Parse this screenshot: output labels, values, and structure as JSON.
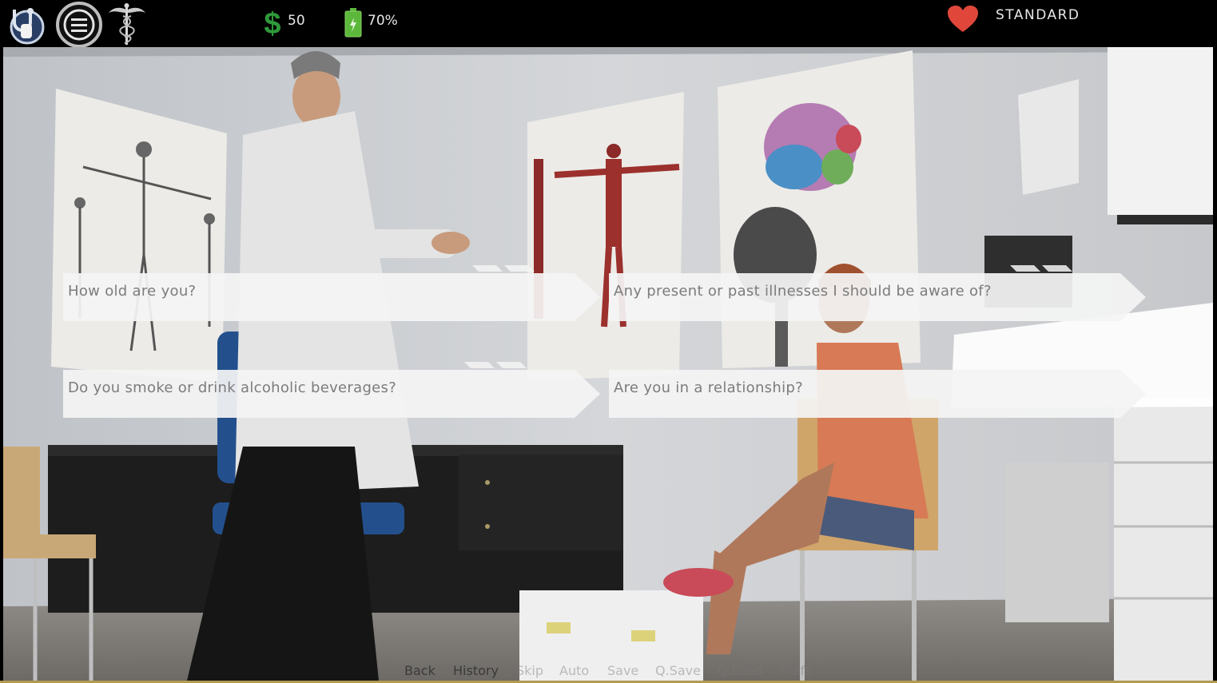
{
  "hud": {
    "money_value": "50",
    "energy_value": "70%",
    "difficulty": "STANDARD",
    "icons": [
      "stethoscope-logo-icon",
      "menu-icon",
      "caduceus-icon",
      "dollar-icon",
      "battery-icon",
      "heart-icon"
    ],
    "colors": {
      "dollar": "#2e9a3a",
      "battery": "#5cb83a",
      "heart": "#e0473a"
    }
  },
  "choices": [
    {
      "label": "How old are you?"
    },
    {
      "label": "Any present or past illnesses I should be aware of?"
    },
    {
      "label": "Do you smoke or drink alcoholic beverages?"
    },
    {
      "label": "Are you in a relationship?"
    }
  ],
  "quick_menu": {
    "back": "Back",
    "history": "History",
    "skip": "Skip",
    "auto": "Auto",
    "save": "Save",
    "qsave": "Q.Save",
    "qload": "Q.Load",
    "prefs": "Prefs"
  }
}
